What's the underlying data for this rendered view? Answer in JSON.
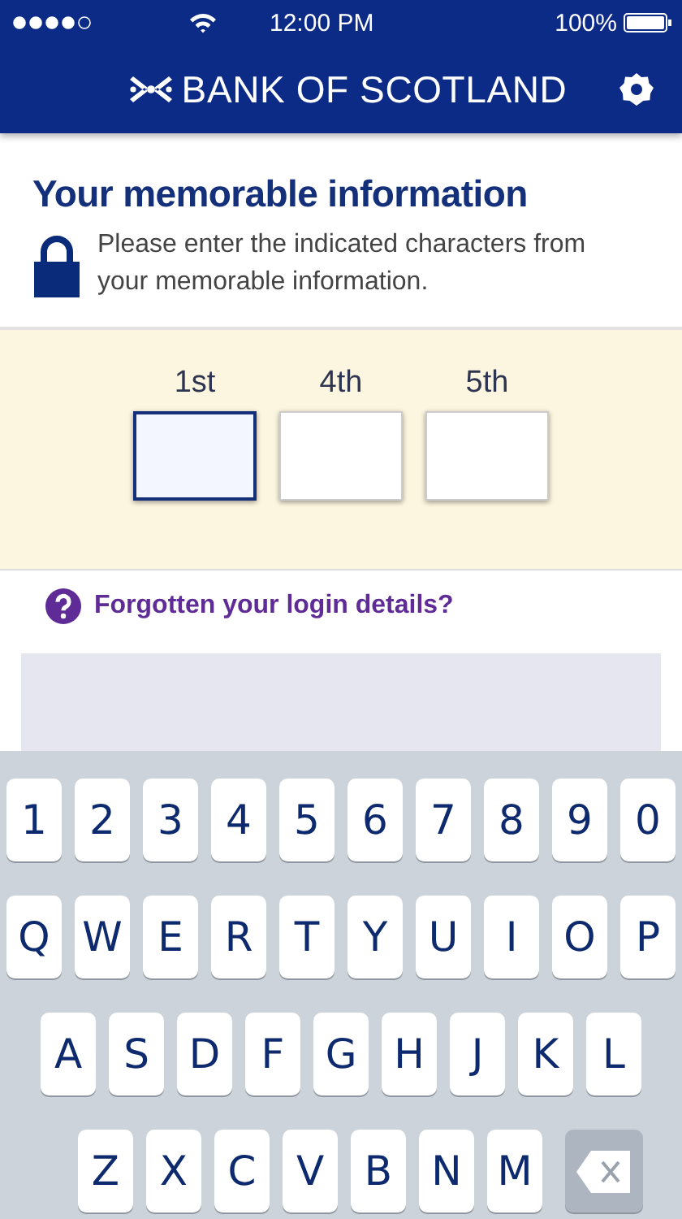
{
  "status_bar": {
    "time": "12:00 PM",
    "battery": "100%"
  },
  "header": {
    "brand": "BANK OF SCOTLAND"
  },
  "memorable": {
    "title": "Your memorable information",
    "instructions": "Please enter the indicated characters from your memorable information.",
    "fields": [
      {
        "label": "1st",
        "selected": true
      },
      {
        "label": "4th",
        "selected": false
      },
      {
        "label": "5th",
        "selected": false
      }
    ]
  },
  "forgotten_link": "Forgotten your login details?",
  "keyboard": {
    "digit_keys": [
      "1",
      "2",
      "3",
      "4",
      "5",
      "6",
      "7",
      "8",
      "9",
      "0"
    ],
    "top_letter_keys": [
      "Q",
      "W",
      "E",
      "R",
      "T",
      "Y",
      "U",
      "I",
      "O",
      "P"
    ],
    "middle_letter_keys": [
      "A",
      "S",
      "D",
      "F",
      "G",
      "H",
      "J",
      "K",
      "L"
    ],
    "bottom_letter_keys": [
      "Z",
      "X",
      "C",
      "V",
      "B",
      "N",
      "M"
    ]
  }
}
